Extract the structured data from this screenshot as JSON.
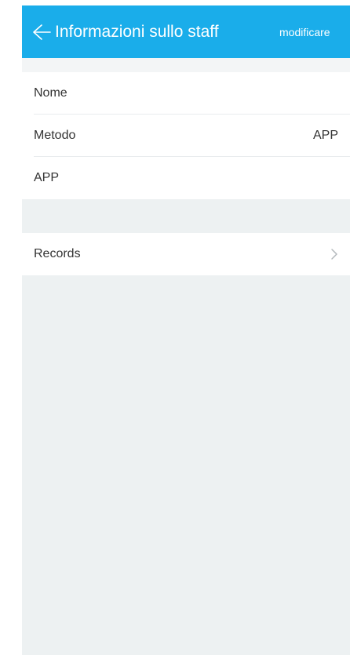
{
  "header": {
    "title": "Informazioni sullo staff",
    "edit_label": "modificare",
    "back_icon": "arrow-left-icon",
    "background_color": "#1aadea"
  },
  "details": {
    "name_label": "Nome",
    "method_label": "Metodo",
    "method_value": "APP",
    "app_label": "APP"
  },
  "records": {
    "label": "Records",
    "icon": "chevron-right-icon"
  }
}
